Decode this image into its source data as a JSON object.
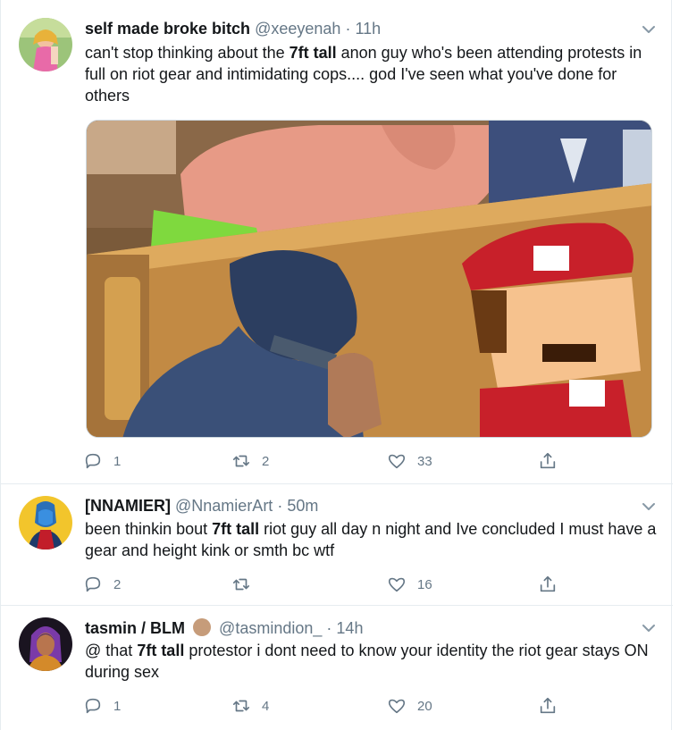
{
  "tweets": [
    {
      "name": "self made broke bitch",
      "handle": "@xeeyenah",
      "dot": "·",
      "time": "11h",
      "text_pre": "can't stop thinking about the ",
      "highlight": "7ft tall",
      "text_post": " anon guy who's been attending protests in full on riot gear and intimidating cops.... god I've seen what you've done for others",
      "reply_count": "1",
      "retweet_count": "2",
      "like_count": "33"
    },
    {
      "name": "[NNAMIER]",
      "handle": "@NnamierArt",
      "dot": "·",
      "time": "50m",
      "text_pre": "been thinkin bout ",
      "highlight": "7ft tall",
      "text_post": " riot guy all day n night and Ive concluded I must have a gear and height kink or smth bc wtf",
      "reply_count": "2",
      "retweet_count": "",
      "like_count": "16"
    },
    {
      "name": "tasmin / BLM",
      "name_emoji": "raised-fist-emoji",
      "handle": "@tasmindion_",
      "dot": "·",
      "time": "14h",
      "text_pre": "@ that ",
      "highlight": "7ft tall",
      "text_post": " protestor i dont need to know your identity the riot gear stays ON during sex",
      "reply_count": "1",
      "retweet_count": "4",
      "like_count": "20"
    }
  ],
  "icons": {
    "reply": "reply-icon",
    "retweet": "retweet-icon",
    "like": "like-icon",
    "share": "share-icon",
    "more": "chevron-down-icon"
  },
  "colors": {
    "text": "#14171a",
    "secondary": "#657786",
    "border": "#e6ecf0"
  }
}
